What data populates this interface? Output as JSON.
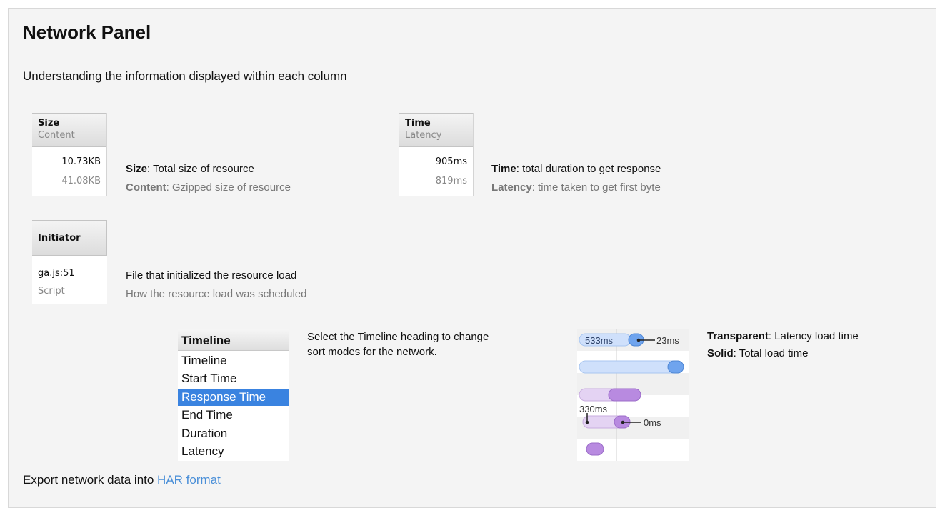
{
  "header": {
    "title": "Network Panel",
    "subtitle": "Understanding the information displayed within each column"
  },
  "size_column": {
    "head1": "Size",
    "head2": "Content",
    "value1": "10.73KB",
    "value2": "41.08KB",
    "desc1_bold": "Size",
    "desc1_rest": ": Total size of resource",
    "desc2_bold": "Content",
    "desc2_rest": ": Gzipped size of resource"
  },
  "time_column": {
    "head1": "Time",
    "head2": "Latency",
    "value1": "905ms",
    "value2": "819ms",
    "desc1_bold": "Time",
    "desc1_rest": ": total duration to get response",
    "desc2_bold": "Latency",
    "desc2_rest": ": time taken to get first byte"
  },
  "initiator_column": {
    "head": "Initiator",
    "link": "ga.js:51",
    "type": "Script",
    "desc1": "File that initialized the resource load",
    "desc2": "How the resource load was scheduled"
  },
  "timeline_menu": {
    "head": "Timeline",
    "items": [
      "Timeline",
      "Start Time",
      "Response Time",
      "End Time",
      "Duration",
      "Latency"
    ],
    "selected": "Response Time",
    "desc_line1": "Select the Timeline heading to change",
    "desc_line2": "sort modes for the network."
  },
  "timeline_chart": {
    "label_latency": "533ms",
    "label_after": "23ms",
    "label_330": "330ms",
    "label_0": "0ms",
    "colors": {
      "blue_light": "#cfe0fb",
      "blue_solid": "#6fa4ee",
      "purple_light": "#e4d3f3",
      "purple_solid": "#b88ae0"
    }
  },
  "legend": {
    "l1_bold": "Transparent",
    "l1_rest": ": Latency load time",
    "l2_bold": "Solid",
    "l2_rest": ": Total load time"
  },
  "footer": {
    "text": "Export network data into ",
    "link": "HAR format"
  },
  "colors": {
    "link": "#4a8fd8",
    "selected": "#3a83e0",
    "panel_bg": "#f4f4f4"
  }
}
